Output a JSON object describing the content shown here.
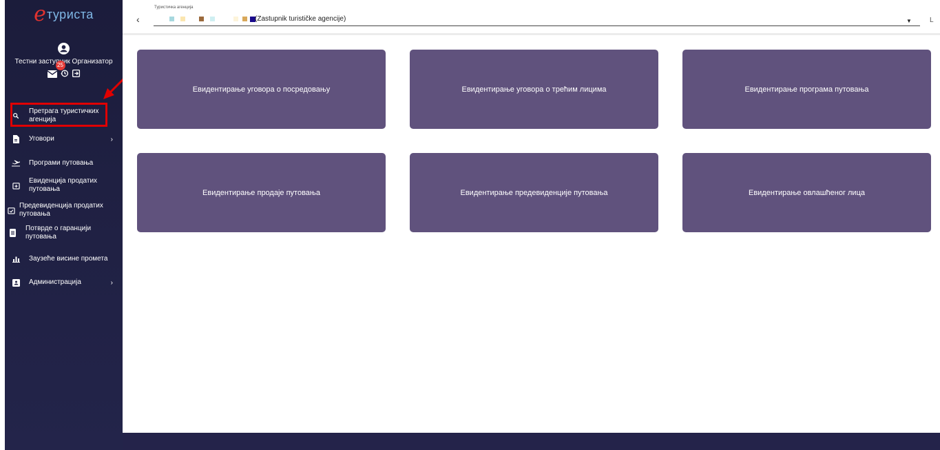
{
  "brand": {
    "e": "e",
    "text": "туриста"
  },
  "user": {
    "name": "Тестни заступник Организатор",
    "badge_count": "25"
  },
  "sidebar": {
    "items": [
      {
        "label": "Претрага туристичких агенција",
        "icon": "search-icon"
      },
      {
        "label": "Уговори",
        "icon": "document-icon",
        "chevron": "›"
      },
      {
        "label": "Програми путовања",
        "icon": "plane-icon"
      },
      {
        "label": "Евиденција продатих путовања",
        "icon": "calendar-plus-icon"
      },
      {
        "label": "Предевиденција продатих путовања",
        "icon": "calendar-check-icon"
      },
      {
        "label": "Потврде о гаранцији путовања",
        "icon": "receipt-icon"
      },
      {
        "label": "Заузеће висине промета",
        "icon": "bar-chart-icon"
      },
      {
        "label": "Администрација",
        "icon": "id-card-icon",
        "chevron": "›"
      }
    ]
  },
  "topbar": {
    "back": "‹",
    "agency_label": "Туристичка агенција",
    "agency_value": "(Zastupnik turističke agencije)",
    "extra": "L"
  },
  "cards": [
    "Евидентирање уговора о посредовању",
    "Евидентирање уговора о трећим лицима",
    "Евидентирање програма путовања",
    "Евидентирање продаје путовања",
    "Евидентирање предевиденције путовања",
    "Евидентирање овлашћеног лица"
  ],
  "colors": {
    "sidebar_bg": "#1f2042",
    "card_bg": "#60527d",
    "highlight": "#e00000",
    "footer": "#24234a"
  }
}
